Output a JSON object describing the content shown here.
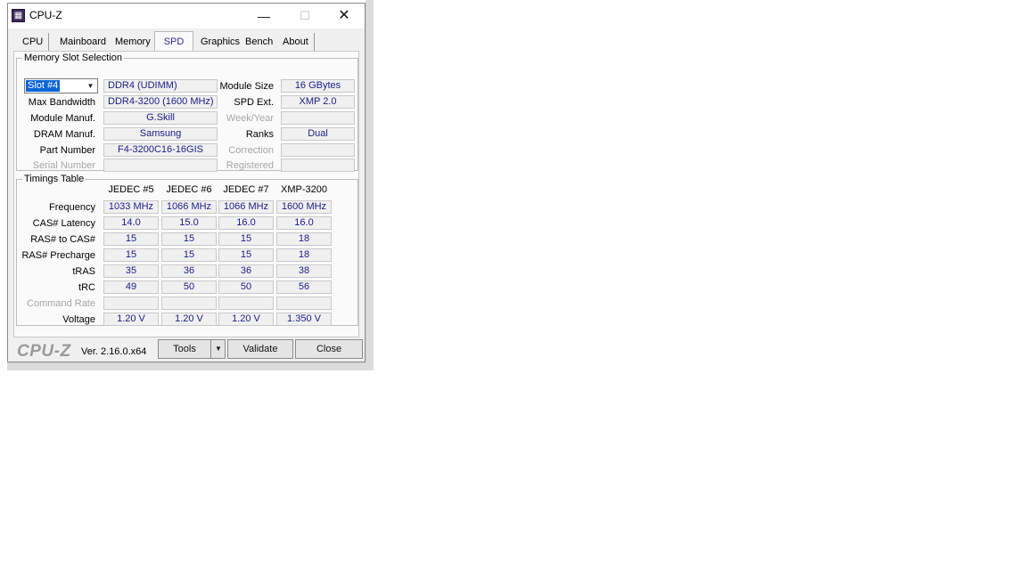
{
  "window": {
    "title": "CPU-Z",
    "controls": {
      "minimize": "—",
      "maximize": "☐",
      "close": "✕"
    }
  },
  "tabs": [
    "CPU",
    "Mainboard",
    "Memory",
    "SPD",
    "Graphics",
    "Bench",
    "About"
  ],
  "active_tab": "SPD",
  "slot_selection": {
    "group_title": "Memory Slot Selection",
    "slot": "Slot #4",
    "memory_type": "DDR4 (UDIMM)",
    "rows": [
      {
        "label": "Max Bandwidth",
        "value": "DDR4-3200 (1600 MHz)"
      },
      {
        "label": "Module Manuf.",
        "value": "G.Skill"
      },
      {
        "label": "DRAM Manuf.",
        "value": "Samsung"
      },
      {
        "label": "Part Number",
        "value": "F4-3200C16-16GIS"
      },
      {
        "label": "Serial Number",
        "value": ""
      }
    ],
    "right_rows": [
      {
        "label": "Module Size",
        "value": "16 GBytes"
      },
      {
        "label": "SPD Ext.",
        "value": "XMP 2.0"
      },
      {
        "label": "Week/Year",
        "value": ""
      },
      {
        "label": "Ranks",
        "value": "Dual"
      },
      {
        "label": "Correction",
        "value": ""
      },
      {
        "label": "Registered",
        "value": ""
      }
    ]
  },
  "timings": {
    "group_title": "Timings Table",
    "columns": [
      "JEDEC #5",
      "JEDEC #6",
      "JEDEC #7",
      "XMP-3200"
    ],
    "rows": [
      {
        "label": "Frequency",
        "values": [
          "1033 MHz",
          "1066 MHz",
          "1066 MHz",
          "1600 MHz"
        ]
      },
      {
        "label": "CAS# Latency",
        "values": [
          "14.0",
          "15.0",
          "16.0",
          "16.0"
        ]
      },
      {
        "label": "RAS# to CAS#",
        "values": [
          "15",
          "15",
          "15",
          "18"
        ]
      },
      {
        "label": "RAS# Precharge",
        "values": [
          "15",
          "15",
          "15",
          "18"
        ]
      },
      {
        "label": "tRAS",
        "values": [
          "35",
          "36",
          "36",
          "38"
        ]
      },
      {
        "label": "tRC",
        "values": [
          "49",
          "50",
          "50",
          "56"
        ]
      },
      {
        "label": "Command Rate",
        "values": [
          "",
          "",
          "",
          ""
        ]
      },
      {
        "label": "Voltage",
        "values": [
          "1.20 V",
          "1.20 V",
          "1.20 V",
          "1.350 V"
        ]
      }
    ]
  },
  "footer": {
    "logo": "CPU-Z",
    "version": "Ver. 2.16.0.x64",
    "tools_label": "Tools",
    "validate_label": "Validate",
    "close_label": "Close"
  }
}
